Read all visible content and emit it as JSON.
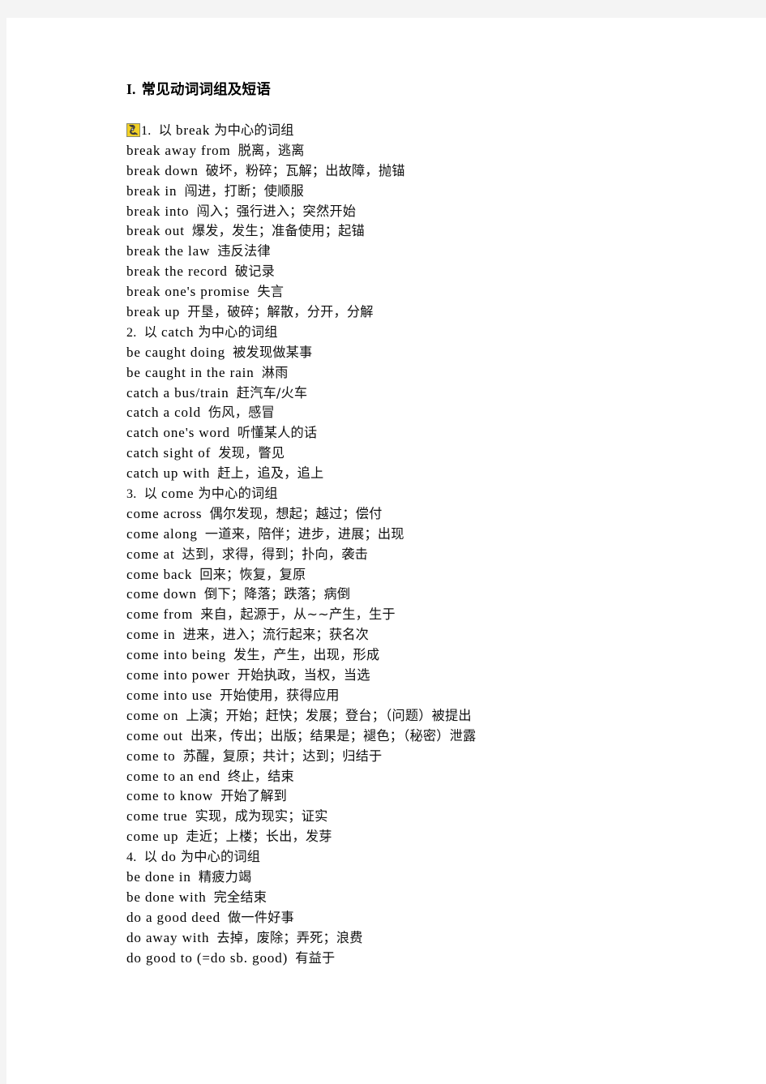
{
  "document": {
    "heading_numeral": "I.",
    "heading_text": "常见动词词组及短语",
    "icon": "ole-object-icon"
  },
  "sections": [
    {
      "number": "1.",
      "title_en": "break",
      "title_prefix": "以",
      "title_suffix": "为中心的词组",
      "entries": [
        {
          "en": "break away from",
          "cn": "脱离，逃离"
        },
        {
          "en": "break down",
          "cn": "破坏，粉碎；瓦解；出故障，抛锚"
        },
        {
          "en": "break in",
          "cn": "闯进，打断；使顺服"
        },
        {
          "en": "break into",
          "cn": "闯入；强行进入；突然开始"
        },
        {
          "en": "break out",
          "cn": "爆发，发生；准备使用；起锚"
        },
        {
          "en": "break the law",
          "cn": "违反法律"
        },
        {
          "en": "break the record",
          "cn": "破记录"
        },
        {
          "en": "break one's promise",
          "cn": "失言"
        },
        {
          "en": "break up",
          "cn": "开垦，破碎；解散，分开，分解"
        }
      ]
    },
    {
      "number": "2.",
      "title_en": "catch",
      "title_prefix": "以",
      "title_suffix": "为中心的词组",
      "entries": [
        {
          "en": "be caught doing",
          "cn": "被发现做某事"
        },
        {
          "en": "be caught in the rain",
          "cn": "淋雨"
        },
        {
          "en": "catch a bus/train",
          "cn": "赶汽车/火车"
        },
        {
          "en": "catch a cold",
          "cn": "伤风，感冒"
        },
        {
          "en": "catch one's word",
          "cn": "听懂某人的话"
        },
        {
          "en": "catch sight of",
          "cn": "发现，瞥见"
        },
        {
          "en": "catch up with",
          "cn": "赶上，追及，追上"
        }
      ]
    },
    {
      "number": "3.",
      "title_en": "come",
      "title_prefix": "以",
      "title_suffix": "为中心的词组",
      "entries": [
        {
          "en": "come across",
          "cn": "偶尔发现，想起；越过；偿付"
        },
        {
          "en": "come along",
          "cn": "一道来，陪伴；进步，进展；出现"
        },
        {
          "en": "come at",
          "cn": "达到，求得，得到；扑向，袭击"
        },
        {
          "en": "come back",
          "cn": "回来；恢复，复原"
        },
        {
          "en": "come down",
          "cn": "倒下；降落；跌落；病倒"
        },
        {
          "en": "come from",
          "cn": "来自，起源于，从~~产生，生于"
        },
        {
          "en": "come in",
          "cn": "进来，进入；流行起来；获名次"
        },
        {
          "en": "come into being",
          "cn": "发生，产生，出现，形成"
        },
        {
          "en": "come into power",
          "cn": "开始执政，当权，当选"
        },
        {
          "en": "come into use",
          "cn": "开始使用，获得应用"
        },
        {
          "en": "come on",
          "cn": "上演；开始；赶快；发展；登台；（问题）被提出"
        },
        {
          "en": "come out",
          "cn": "出来，传出；出版；结果是；褪色；（秘密）泄露"
        },
        {
          "en": "come to",
          "cn": "苏醒，复原；共计；达到；归结于"
        },
        {
          "en": "come to an end",
          "cn": "终止，结束"
        },
        {
          "en": "come to know",
          "cn": "开始了解到"
        },
        {
          "en": "come true",
          "cn": "实现，成为现实；证实"
        },
        {
          "en": "come up",
          "cn": "走近；上楼；长出，发芽"
        }
      ]
    },
    {
      "number": "4.",
      "title_en": "do",
      "title_prefix": "以",
      "title_suffix": "为中心的词组",
      "entries": [
        {
          "en": "be done in",
          "cn": "精疲力竭"
        },
        {
          "en": "be done with",
          "cn": "完全结束"
        },
        {
          "en": "do a good deed",
          "cn": "做一件好事"
        },
        {
          "en": "do away with",
          "cn": "去掉，废除；弄死；浪费"
        },
        {
          "en": "do good to (=do sb. good)",
          "cn": "有益于"
        }
      ]
    }
  ]
}
